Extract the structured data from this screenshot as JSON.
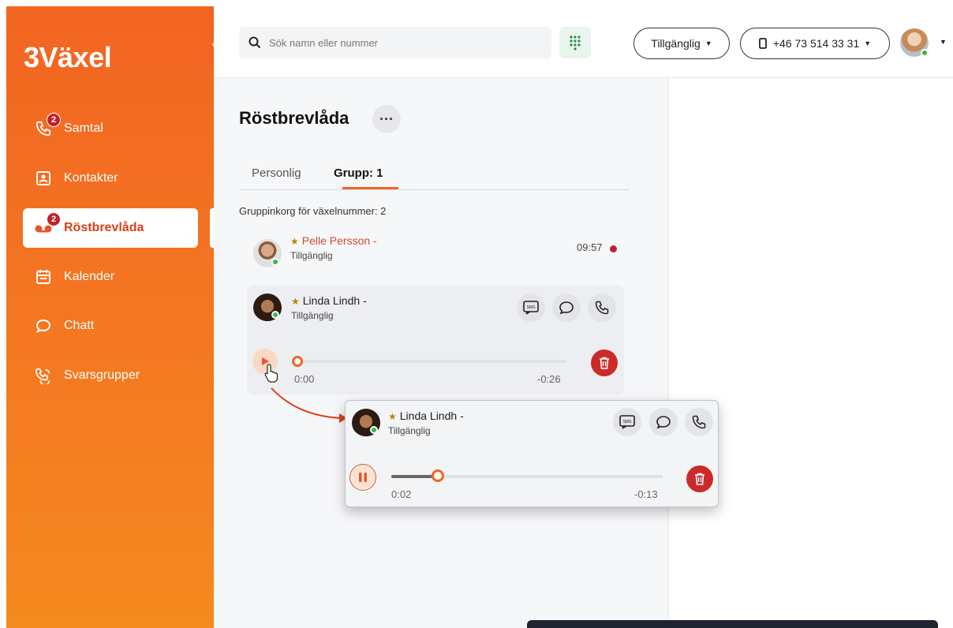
{
  "app": {
    "logo": "3Växel"
  },
  "sidebar": {
    "items": [
      {
        "label": "Samtal",
        "icon": "phone-icon",
        "badge": "2"
      },
      {
        "label": "Kontakter",
        "icon": "contact-card-icon",
        "badge": ""
      },
      {
        "label": "Röstbrevlåda",
        "icon": "voicemail-icon",
        "badge": "2"
      },
      {
        "label": "Kalender",
        "icon": "calendar-icon",
        "badge": ""
      },
      {
        "label": "Chatt",
        "icon": "chat-bubble-icon",
        "badge": ""
      },
      {
        "label": "Svarsgrupper",
        "icon": "group-phone-icon",
        "badge": ""
      }
    ],
    "active": "Röstbrevlåda"
  },
  "topbar": {
    "search_placeholder": "Sök namn eller nummer",
    "status_label": "Tillgänglig",
    "phone_label": "+46 73 514 33 31"
  },
  "page": {
    "title": "Röstbrevlåda",
    "tabs": [
      {
        "label": "Personlig"
      },
      {
        "label": "Grupp: 1"
      }
    ],
    "active_tab": "Grupp: 1",
    "group_label": "Gruppinkorg för växelnummer: 2"
  },
  "messages": [
    {
      "name": "Pelle Persson",
      "dash": "-",
      "status": "Tillgänglig",
      "time": "09:57",
      "unread": true
    }
  ],
  "expanded_message": {
    "name": "Linda Lindh",
    "dash": "-",
    "status": "Tillgänglig",
    "elapsed": "0:00",
    "remaining": "-0:26",
    "progress": 0.0,
    "actions": [
      "sms-icon",
      "chat-bubble-icon",
      "phone-icon"
    ]
  },
  "popup_message": {
    "name": "Linda Lindh",
    "dash": "-",
    "status": "Tillgänglig",
    "elapsed": "0:02",
    "remaining": "-0:13",
    "progress": 0.16,
    "actions": [
      "sms-icon",
      "chat-bubble-icon",
      "phone-icon"
    ]
  },
  "colors": {
    "brand": "#f26522",
    "danger": "#cc2a2a",
    "online": "#3bb54a",
    "unread": "#c0232a"
  }
}
